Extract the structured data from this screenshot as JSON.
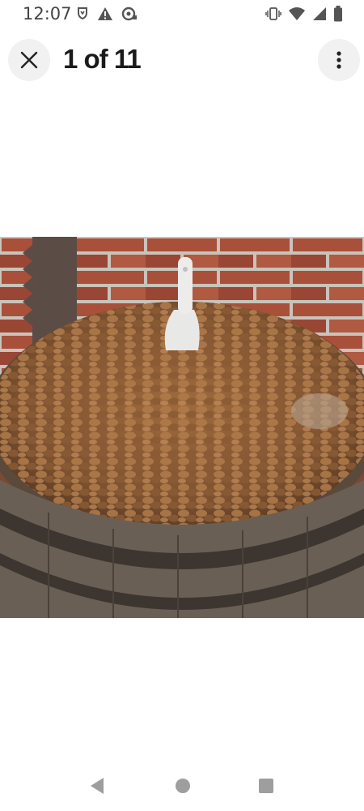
{
  "status_bar": {
    "time": "12:07",
    "left_icons": [
      "shield-icon",
      "warning-icon",
      "sync-icon"
    ],
    "right_icons": [
      "vibrate-icon",
      "wifi-icon",
      "cell-signal-icon",
      "battery-icon"
    ]
  },
  "viewer": {
    "counter": "1 of 11",
    "close_icon": "close-icon",
    "menu_icon": "more-vert-icon"
  },
  "photo": {
    "subject": "image"
  },
  "nav_bar": {
    "buttons": [
      "back-icon",
      "home-icon",
      "recents-icon"
    ]
  },
  "colors": {
    "button_bg": "#f1f1f1",
    "text": "#1a1a1a",
    "nav_icon": "#9e9e9e"
  }
}
